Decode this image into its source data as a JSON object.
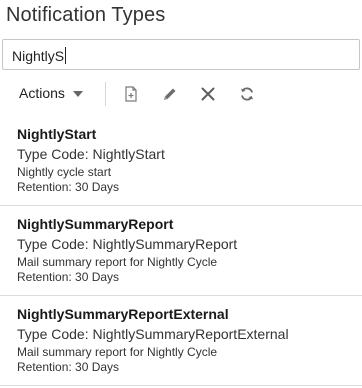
{
  "page": {
    "title": "Notification Types"
  },
  "search": {
    "value": "NightlyS"
  },
  "toolbar": {
    "actions_label": "Actions",
    "icons": [
      "new-document-icon",
      "edit-pencil-icon",
      "delete-x-icon",
      "refresh-icon"
    ]
  },
  "items": [
    {
      "name": "NightlyStart",
      "type_code": "Type Code: NightlyStart",
      "description": "Nightly cycle start",
      "retention": "Retention: 30 Days"
    },
    {
      "name": "NightlySummaryReport",
      "type_code": "Type Code: NightlySummaryReport",
      "description": "Mail summary report for Nightly Cycle",
      "retention": "Retention: 30 Days"
    },
    {
      "name": "NightlySummaryReportExternal",
      "type_code": "Type Code: NightlySummaryReportExternal",
      "description": "Mail summary report for Nightly Cycle",
      "retention": "Retention: 30 Days"
    }
  ]
}
